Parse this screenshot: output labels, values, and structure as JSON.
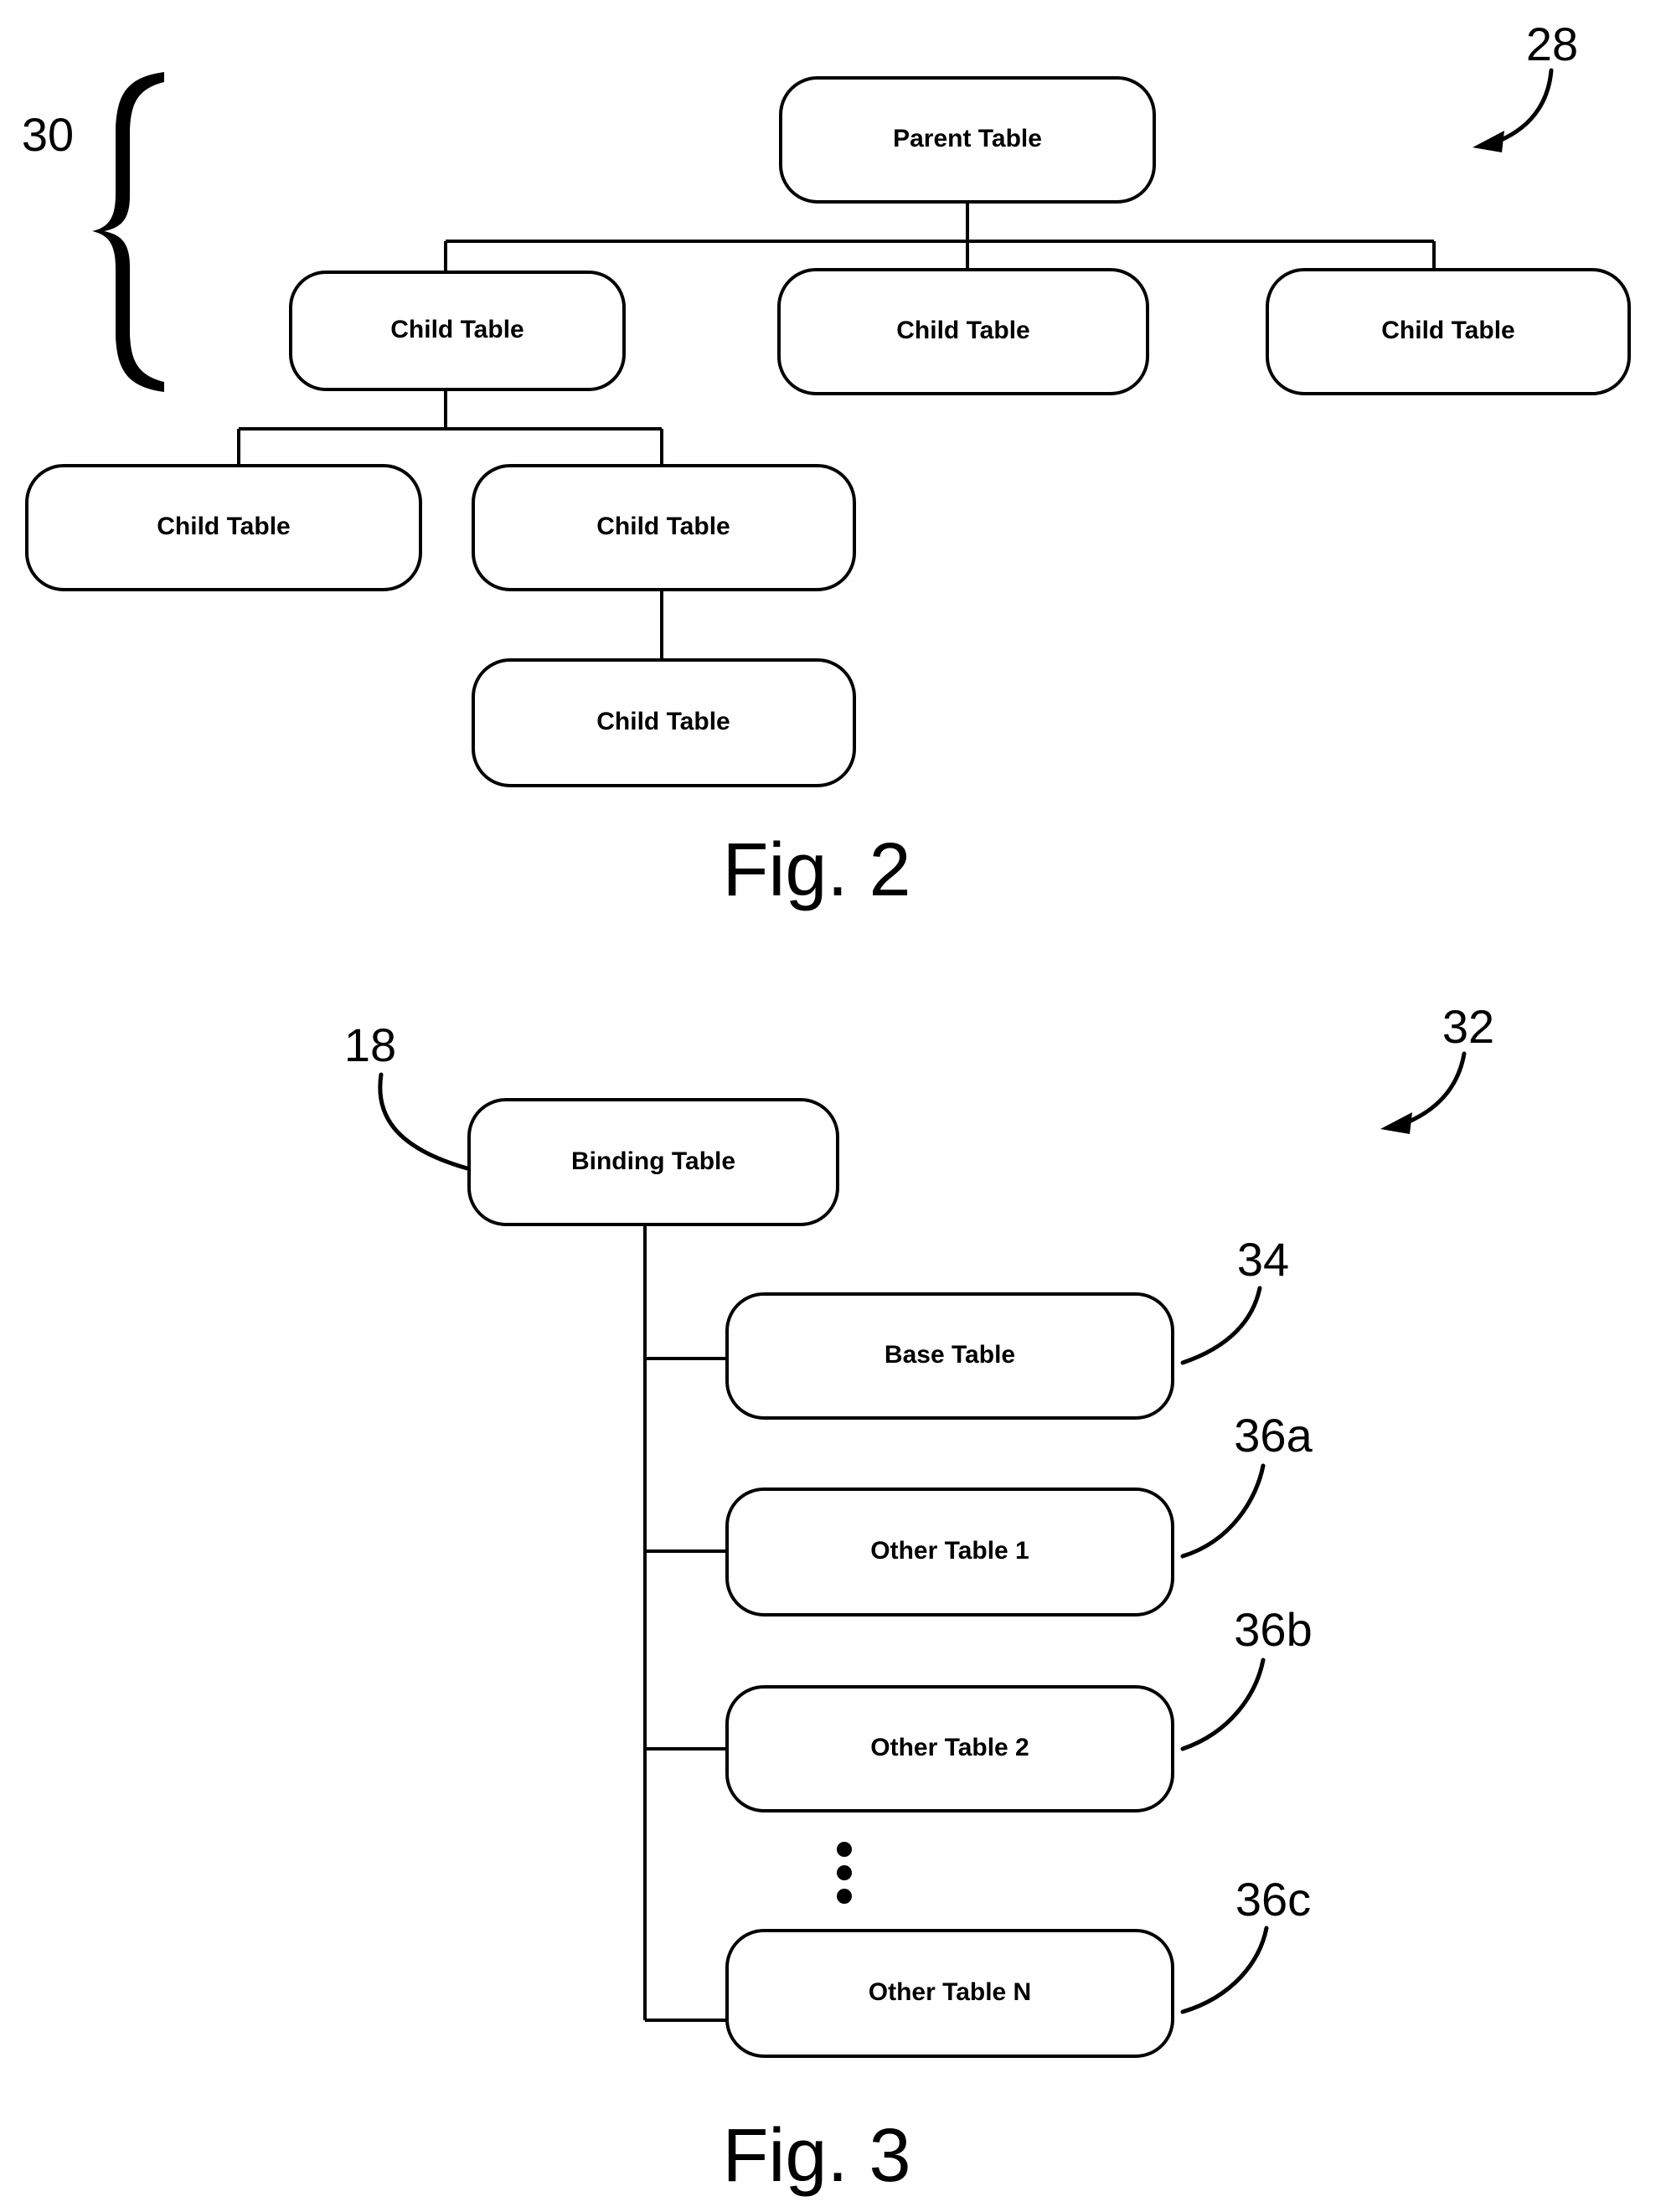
{
  "document": {
    "type": "patent-drawing-sheet",
    "figures": [
      {
        "id": "fig2",
        "caption": "Fig. 2",
        "reference_numeral": "28",
        "group_bracket_label": "30",
        "diagram_type": "hierarchical-tree",
        "nodes": [
          {
            "id": "n1",
            "label": "Parent Table",
            "level": 1
          },
          {
            "id": "n2",
            "label": "Child Table",
            "level": 2
          },
          {
            "id": "n3",
            "label": "Child Table",
            "level": 2
          },
          {
            "id": "n4",
            "label": "Child Table",
            "level": 2
          },
          {
            "id": "n5",
            "label": "Child Table",
            "level": 3
          },
          {
            "id": "n6",
            "label": "Child Table",
            "level": 3
          },
          {
            "id": "n7",
            "label": "Child Table",
            "level": 4
          }
        ],
        "edges": [
          {
            "from": "n1",
            "to": "n2"
          },
          {
            "from": "n1",
            "to": "n3"
          },
          {
            "from": "n1",
            "to": "n4"
          },
          {
            "from": "n2",
            "to": "n5"
          },
          {
            "from": "n2",
            "to": "n6"
          },
          {
            "from": "n6",
            "to": "n7"
          }
        ]
      },
      {
        "id": "fig3",
        "caption": "Fig. 3",
        "reference_numeral": "32",
        "diagram_type": "binding-table-bus",
        "root": {
          "id": "b1",
          "label": "Binding Table",
          "reference_numeral": "18"
        },
        "children": [
          {
            "id": "b2",
            "label": "Base Table",
            "reference_numeral": "34"
          },
          {
            "id": "b3",
            "label": "Other Table 1",
            "reference_numeral": "36a"
          },
          {
            "id": "b4",
            "label": "Other Table 2",
            "reference_numeral": "36b"
          },
          {
            "id": "b5",
            "label": "Other Table N",
            "reference_numeral": "36c"
          }
        ],
        "ellipsis": "vertical-dots"
      }
    ],
    "colors": {
      "ink": "#000000",
      "paper": "#ffffff"
    }
  }
}
